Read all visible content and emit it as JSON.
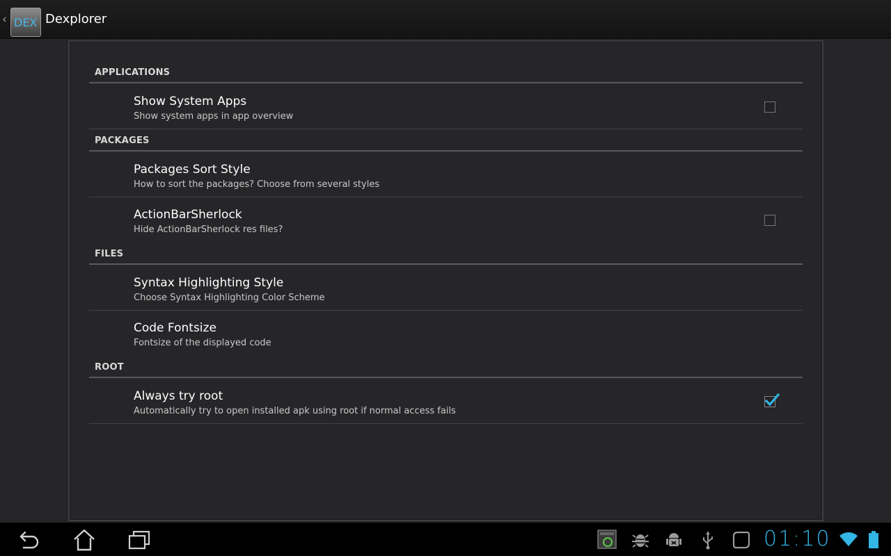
{
  "actionbar": {
    "app_title": "Dexplorer",
    "icon_text": "DEX",
    "up_caret": "‹"
  },
  "categories": {
    "applications": "APPLICATIONS",
    "packages": "PACKAGES",
    "files": "FILES",
    "root": "ROOT"
  },
  "prefs": {
    "show_system_apps": {
      "title": "Show System Apps",
      "summary": "Show system apps in app overview",
      "checked": false
    },
    "packages_sort_style": {
      "title": "Packages Sort Style",
      "summary": "How to sort the packages? Choose from several styles"
    },
    "actionbarsherlock": {
      "title": "ActionBarSherlock",
      "summary": "Hide ActionBarSherlock res files?",
      "checked": false
    },
    "syntax_highlighting_style": {
      "title": "Syntax Highlighting Style",
      "summary": "Choose Syntax Highlighting Color Scheme"
    },
    "code_fontsize": {
      "title": "Code Fontsize",
      "summary": "Fontsize of the displayed code"
    },
    "always_try_root": {
      "title": "Always try root",
      "summary": "Automatically try to open installed apk using root if normal access fails",
      "checked": true
    }
  },
  "systembar": {
    "clock": "01:10",
    "nav_icons": [
      "back-icon",
      "home-icon",
      "recent-apps-icon"
    ],
    "status_icons": [
      "screenshot-notification-icon",
      "debug-bug-icon",
      "android-debug-icon",
      "usb-icon",
      "sync-icon",
      "wifi-icon",
      "battery-icon"
    ]
  },
  "colors": {
    "accent": "#33b5e5",
    "background": "#26262a",
    "bar": "#000000"
  }
}
